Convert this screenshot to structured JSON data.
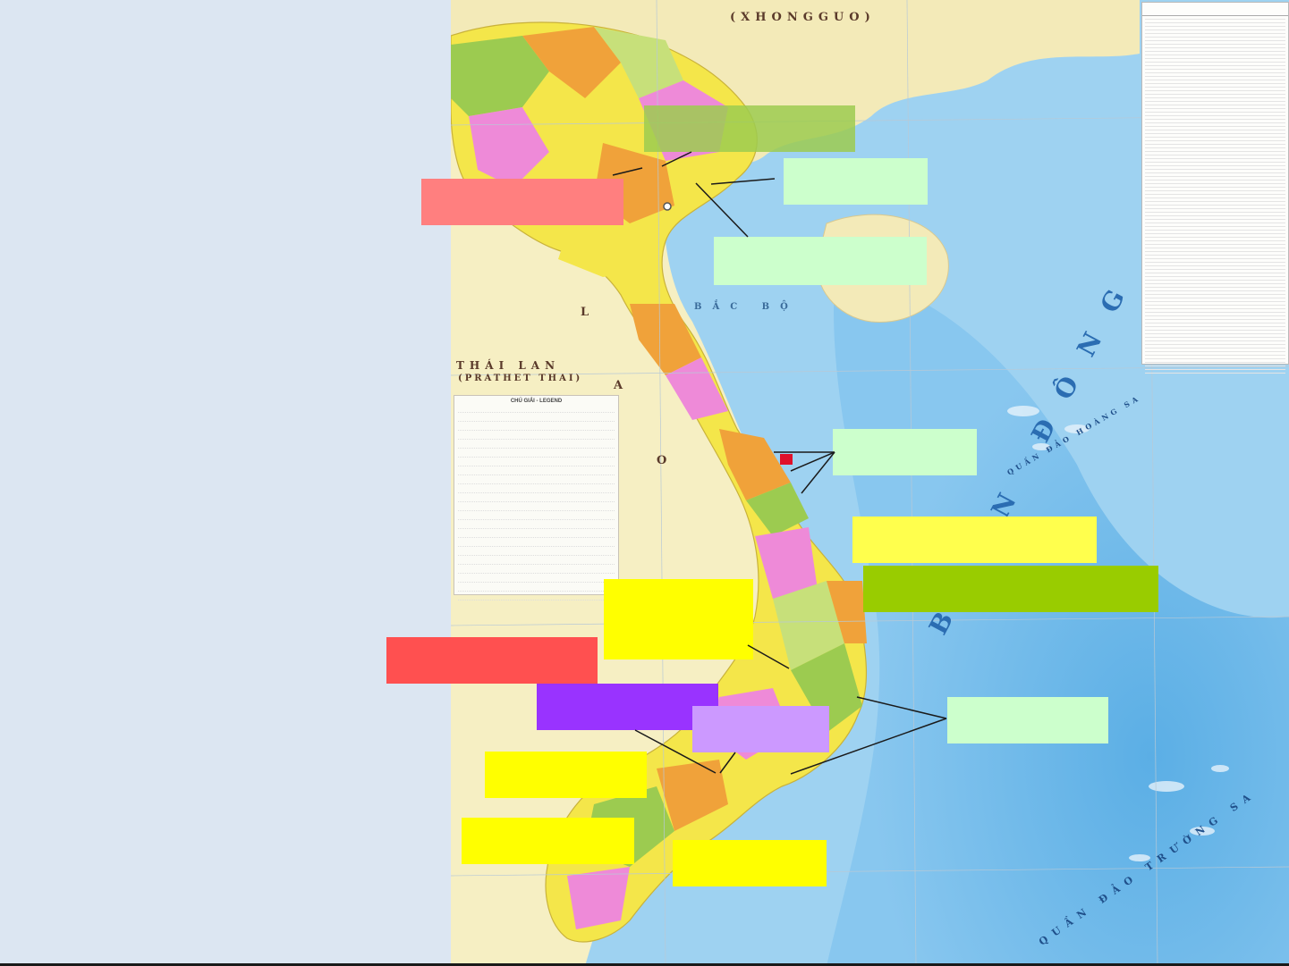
{
  "map": {
    "labels": {
      "china": "(XHONGGUO)",
      "gulf": "BẮC BỘ",
      "thailand": "THÁI LAN",
      "thailand_sub": "(PRATHET THAI)",
      "laos_l": "L",
      "laos_a": "A",
      "laos_o": "O",
      "sea": "BIỂN ĐÔNG",
      "spratly": "QUẦN ĐẢO TRƯỜNG SA",
      "paracel": "QUẦN ĐẢO HOÀNG SA"
    },
    "legend": {
      "title": "CHÚ GIẢI - LEGEND",
      "rows": 22
    },
    "stats_table": {
      "rows": 100
    }
  },
  "colors": {
    "sea": "#8ec9ee",
    "sea_deep": "#5fb0e6",
    "land": "#f3eab8",
    "province_yellow": "#f4e64a",
    "province_pink": "#ee8ad8",
    "province_green": "#9ccb50",
    "province_orange": "#f0a23a"
  }
}
